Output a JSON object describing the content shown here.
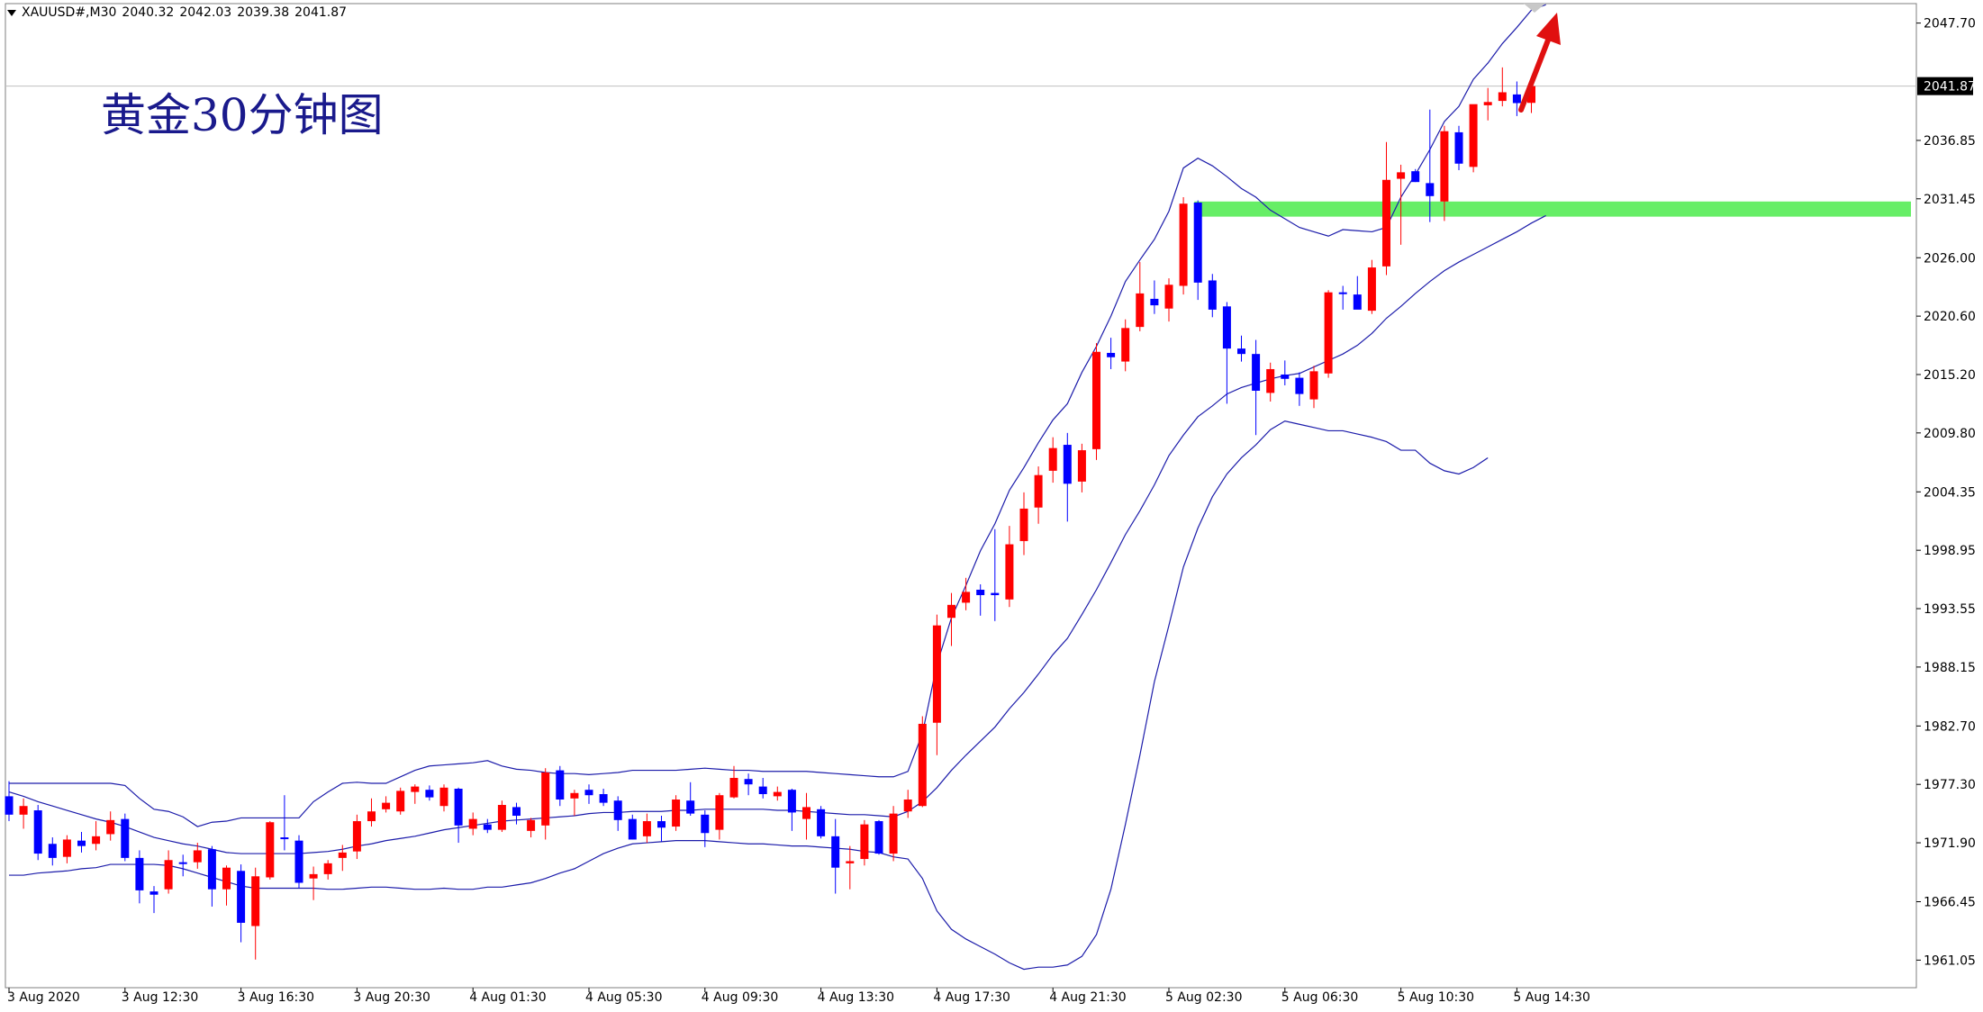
{
  "header": {
    "symbol": "XAUUSD#,M30",
    "open": "2040.32",
    "high": "2042.03",
    "low": "2039.38",
    "close": "2041.87"
  },
  "annotation": {
    "text": "黄金30分钟图"
  },
  "chart_data": {
    "type": "candlestick",
    "timeframe": "M30",
    "ylim": [
      1958.5,
      2049.5
    ],
    "y_ticks": [
      "2047.70",
      "2041.87",
      "2036.85",
      "2031.45",
      "2026.00",
      "2020.60",
      "2015.20",
      "2009.80",
      "2004.35",
      "1998.95",
      "1993.55",
      "1988.15",
      "1982.70",
      "1977.30",
      "1971.90",
      "1966.45",
      "1961.05"
    ],
    "current_price": "2041.87",
    "x_labels": [
      "3 Aug 2020",
      "3 Aug 12:30",
      "3 Aug 16:30",
      "3 Aug 20:30",
      "4 Aug 01:30",
      "4 Aug 05:30",
      "4 Aug 09:30",
      "4 Aug 13:30",
      "4 Aug 17:30",
      "4 Aug 21:30",
      "5 Aug 02:30",
      "5 Aug 06:30",
      "5 Aug 10:30",
      "5 Aug 14:30"
    ],
    "x_label_every": 8,
    "colors": {
      "bull": "#ff0000",
      "bear": "#0000ff",
      "band": "#1c1caa",
      "zone": "#66ee66",
      "arrow": "#e01010",
      "grid": "#c0c0c0"
    },
    "support_zone": [
      2029.8,
      2031.2
    ],
    "candles": [
      [
        1976.2,
        1977.6,
        1973.9,
        1974.5
      ],
      [
        1974.5,
        1976.0,
        1973.2,
        1975.3
      ],
      [
        1974.9,
        1975.4,
        1970.3,
        1970.9
      ],
      [
        1971.8,
        1972.4,
        1969.8,
        1970.5
      ],
      [
        1970.6,
        1972.6,
        1970.0,
        1972.2
      ],
      [
        1972.1,
        1972.9,
        1971.0,
        1971.6
      ],
      [
        1971.8,
        1973.9,
        1971.2,
        1972.5
      ],
      [
        1972.7,
        1974.8,
        1972.1,
        1974.0
      ],
      [
        1974.1,
        1974.6,
        1970.2,
        1970.5
      ],
      [
        1970.5,
        1971.2,
        1966.3,
        1967.5
      ],
      [
        1967.4,
        1967.9,
        1965.4,
        1967.1
      ],
      [
        1967.6,
        1971.2,
        1967.2,
        1970.3
      ],
      [
        1970.1,
        1970.8,
        1968.8,
        1970.0
      ],
      [
        1970.1,
        1971.9,
        1969.5,
        1971.2
      ],
      [
        1971.3,
        1971.6,
        1966.0,
        1967.6
      ],
      [
        1967.6,
        1969.8,
        1966.1,
        1969.6
      ],
      [
        1969.3,
        1969.9,
        1962.7,
        1964.5
      ],
      [
        1964.2,
        1969.6,
        1961.1,
        1968.8
      ],
      [
        1968.7,
        1973.9,
        1968.5,
        1973.8
      ],
      [
        1972.4,
        1976.3,
        1971.2,
        1972.3
      ],
      [
        1972.1,
        1972.6,
        1967.7,
        1968.2
      ],
      [
        1968.6,
        1969.7,
        1966.6,
        1969.0
      ],
      [
        1969.0,
        1970.3,
        1968.5,
        1970.0
      ],
      [
        1970.5,
        1971.7,
        1969.3,
        1971.0
      ],
      [
        1971.1,
        1974.5,
        1970.4,
        1973.9
      ],
      [
        1973.9,
        1976.0,
        1973.4,
        1974.8
      ],
      [
        1975.0,
        1976.2,
        1974.7,
        1975.6
      ],
      [
        1974.8,
        1977.0,
        1974.5,
        1976.7
      ],
      [
        1976.6,
        1977.3,
        1975.5,
        1977.1
      ],
      [
        1976.8,
        1977.2,
        1975.8,
        1976.1
      ],
      [
        1975.3,
        1977.3,
        1974.8,
        1977.0
      ],
      [
        1976.9,
        1977.0,
        1971.9,
        1973.5
      ],
      [
        1973.2,
        1974.7,
        1972.6,
        1974.1
      ],
      [
        1973.6,
        1974.1,
        1972.8,
        1973.1
      ],
      [
        1973.1,
        1975.8,
        1972.9,
        1975.4
      ],
      [
        1975.2,
        1975.6,
        1973.6,
        1974.4
      ],
      [
        1973.0,
        1974.2,
        1972.4,
        1974.0
      ],
      [
        1973.5,
        1978.8,
        1972.2,
        1978.4
      ],
      [
        1978.6,
        1979.0,
        1975.3,
        1975.9
      ],
      [
        1976.0,
        1976.8,
        1974.4,
        1976.5
      ],
      [
        1976.8,
        1977.3,
        1975.5,
        1976.3
      ],
      [
        1976.4,
        1976.9,
        1975.3,
        1975.6
      ],
      [
        1975.8,
        1976.2,
        1973.0,
        1974.0
      ],
      [
        1974.1,
        1974.5,
        1972.2,
        1972.2
      ],
      [
        1972.5,
        1974.6,
        1971.9,
        1973.9
      ],
      [
        1973.9,
        1974.4,
        1972.0,
        1973.3
      ],
      [
        1973.4,
        1976.3,
        1973.0,
        1975.9
      ],
      [
        1975.8,
        1977.5,
        1974.4,
        1974.6
      ],
      [
        1974.5,
        1974.9,
        1971.5,
        1972.8
      ],
      [
        1973.1,
        1976.5,
        1972.2,
        1976.3
      ],
      [
        1976.1,
        1979.0,
        1976.0,
        1977.9
      ],
      [
        1977.8,
        1978.3,
        1976.3,
        1977.3
      ],
      [
        1977.1,
        1977.9,
        1976.0,
        1976.4
      ],
      [
        1976.2,
        1977.1,
        1975.8,
        1976.6
      ],
      [
        1976.8,
        1976.9,
        1973.0,
        1974.7
      ],
      [
        1974.1,
        1976.5,
        1972.2,
        1975.2
      ],
      [
        1975.0,
        1975.3,
        1972.3,
        1972.5
      ],
      [
        1972.5,
        1974.1,
        1967.2,
        1969.6
      ],
      [
        1970.0,
        1971.6,
        1967.6,
        1970.2
      ],
      [
        1970.4,
        1974.0,
        1969.8,
        1973.6
      ],
      [
        1973.9,
        1974.0,
        1970.8,
        1970.9
      ],
      [
        1970.9,
        1975.3,
        1970.2,
        1974.6
      ],
      [
        1974.8,
        1976.8,
        1974.2,
        1975.9
      ],
      [
        1975.3,
        1983.6,
        1975.2,
        1982.9
      ],
      [
        1983.0,
        1993.0,
        1980.0,
        1992.0
      ],
      [
        1992.7,
        1995.0,
        1990.1,
        1993.9
      ],
      [
        1994.1,
        1996.4,
        1993.4,
        1995.1
      ],
      [
        1995.3,
        1995.8,
        1992.9,
        1994.8
      ],
      [
        1995.0,
        2000.9,
        1992.4,
        1994.8
      ],
      [
        1994.4,
        2001.2,
        1993.7,
        1999.5
      ],
      [
        1999.8,
        2004.3,
        1998.5,
        2002.8
      ],
      [
        2002.9,
        2006.7,
        2001.4,
        2005.9
      ],
      [
        2006.3,
        2009.4,
        2005.2,
        2008.4
      ],
      [
        2008.7,
        2009.8,
        2001.6,
        2005.1
      ],
      [
        2005.3,
        2008.8,
        2004.3,
        2008.2
      ],
      [
        2008.3,
        2018.1,
        2007.3,
        2017.3
      ],
      [
        2017.2,
        2018.6,
        2015.7,
        2016.8
      ],
      [
        2016.4,
        2020.3,
        2015.5,
        2019.5
      ],
      [
        2019.6,
        2025.6,
        2019.2,
        2022.7
      ],
      [
        2022.2,
        2023.9,
        2020.8,
        2021.6
      ],
      [
        2021.3,
        2024.1,
        2020.1,
        2023.5
      ],
      [
        2023.4,
        2031.6,
        2022.6,
        2031.0
      ],
      [
        2031.1,
        2031.3,
        2022.1,
        2023.7
      ],
      [
        2023.9,
        2024.5,
        2020.5,
        2021.2
      ],
      [
        2021.5,
        2021.9,
        2012.5,
        2017.6
      ],
      [
        2017.6,
        2018.8,
        2016.4,
        2017.1
      ],
      [
        2017.1,
        2018.4,
        2009.6,
        2013.7
      ],
      [
        2013.5,
        2016.3,
        2012.7,
        2015.7
      ],
      [
        2015.2,
        2016.5,
        2014.2,
        2014.8
      ],
      [
        2014.9,
        2015.4,
        2012.3,
        2013.4
      ],
      [
        2012.9,
        2016.0,
        2012.1,
        2015.5
      ],
      [
        2015.3,
        2023.0,
        2014.9,
        2022.8
      ],
      [
        2022.8,
        2023.4,
        2021.2,
        2022.7
      ],
      [
        2022.6,
        2024.3,
        2021.3,
        2021.2
      ],
      [
        2021.1,
        2025.8,
        2020.8,
        2025.1
      ],
      [
        2025.2,
        2036.7,
        2024.4,
        2033.2
      ],
      [
        2033.3,
        2034.6,
        2027.2,
        2033.9
      ],
      [
        2034.0,
        2034.2,
        2033.0,
        2033.0
      ],
      [
        2032.9,
        2039.7,
        2029.3,
        2031.7
      ],
      [
        2031.2,
        2038.2,
        2029.4,
        2037.7
      ],
      [
        2037.6,
        2038.2,
        2034.1,
        2034.7
      ],
      [
        2034.4,
        2039.7,
        2033.9,
        2040.2
      ],
      [
        2040.1,
        2041.7,
        2038.7,
        2040.4
      ],
      [
        2040.5,
        2043.6,
        2040.0,
        2041.3
      ],
      [
        2041.1,
        2042.3,
        2039.1,
        2040.3
      ],
      [
        2040.32,
        2042.03,
        2039.38,
        2041.87
      ]
    ],
    "bollinger": {
      "upper": [
        1977.4,
        1977.4,
        1977.4,
        1977.4,
        1977.4,
        1977.4,
        1977.4,
        1977.4,
        1977.2,
        1976.0,
        1975.0,
        1974.8,
        1974.3,
        1973.4,
        1973.8,
        1973.9,
        1974.2,
        1974.2,
        1974.2,
        1974.2,
        1974.2,
        1975.7,
        1976.6,
        1977.4,
        1977.5,
        1977.4,
        1977.4,
        1978.0,
        1978.6,
        1979.0,
        1979.1,
        1979.2,
        1979.3,
        1979.5,
        1979.0,
        1978.7,
        1978.6,
        1978.4,
        1978.3,
        1978.3,
        1978.2,
        1978.3,
        1978.4,
        1978.6,
        1978.6,
        1978.6,
        1978.6,
        1978.7,
        1978.8,
        1978.7,
        1978.6,
        1978.6,
        1978.5,
        1978.5,
        1978.5,
        1978.5,
        1978.4,
        1978.3,
        1978.2,
        1978.1,
        1978.0,
        1978.0,
        1978.5,
        1982.0,
        1988.4,
        1992.7,
        1995.7,
        1998.9,
        2001.4,
        2004.5,
        2006.6,
        2008.9,
        2011.0,
        2012.5,
        2015.4,
        2017.8,
        2020.6,
        2023.8,
        2025.8,
        2027.7,
        2030.3,
        2034.3,
        2035.2,
        2034.5,
        2033.5,
        2032.4,
        2031.6,
        2030.4,
        2029.6,
        2028.8,
        2028.4,
        2028.0,
        2028.6,
        2028.5,
        2028.4,
        2028.8,
        2031.6,
        2033.7,
        2036.0,
        2038.6,
        2040.0,
        2042.5,
        2044.0,
        2045.8,
        2047.3,
        2048.9,
        2049.4
      ],
      "middle": [
        1976.6,
        1976.2,
        1975.7,
        1975.3,
        1974.9,
        1974.5,
        1974.1,
        1973.8,
        1973.4,
        1972.9,
        1972.4,
        1972.1,
        1971.8,
        1971.6,
        1971.3,
        1971.0,
        1970.9,
        1970.9,
        1970.9,
        1970.9,
        1970.9,
        1971.0,
        1971.1,
        1971.3,
        1971.6,
        1971.8,
        1972.1,
        1972.3,
        1972.5,
        1972.8,
        1973.1,
        1973.3,
        1973.5,
        1973.7,
        1973.9,
        1974.0,
        1974.1,
        1974.2,
        1974.3,
        1974.4,
        1974.6,
        1974.7,
        1974.7,
        1974.8,
        1974.8,
        1974.8,
        1974.9,
        1974.9,
        1975.0,
        1975.0,
        1975.0,
        1975.0,
        1975.0,
        1974.9,
        1974.9,
        1974.8,
        1974.7,
        1974.6,
        1974.5,
        1974.5,
        1974.4,
        1974.3,
        1974.8,
        1975.7,
        1977.0,
        1978.6,
        1980.0,
        1981.3,
        1982.6,
        1984.3,
        1985.8,
        1987.5,
        1989.3,
        1990.8,
        1993.0,
        1995.3,
        1997.8,
        2000.4,
        2002.6,
        2005.0,
        2007.7,
        2009.6,
        2011.3,
        2012.3,
        2013.4,
        2014.0,
        2014.4,
        2014.8,
        2015.1,
        2015.3,
        2015.9,
        2016.5,
        2017.1,
        2017.9,
        2019.0,
        2020.4,
        2021.5,
        2022.7,
        2023.8,
        2024.8,
        2025.6,
        2026.3,
        2027.0,
        2027.7,
        2028.4,
        2029.2,
        2029.9
      ],
      "lower": [
        1968.9,
        1968.9,
        1969.1,
        1969.2,
        1969.3,
        1969.5,
        1969.6,
        1969.9,
        1969.9,
        1969.9,
        1969.9,
        1969.8,
        1969.5,
        1969.1,
        1968.7,
        1968.3,
        1967.9,
        1967.7,
        1967.7,
        1967.7,
        1967.7,
        1967.7,
        1967.6,
        1967.6,
        1967.7,
        1967.8,
        1967.8,
        1967.7,
        1967.6,
        1967.6,
        1967.7,
        1967.6,
        1967.6,
        1967.8,
        1967.8,
        1968.0,
        1968.2,
        1968.6,
        1969.1,
        1969.5,
        1970.2,
        1970.9,
        1971.4,
        1971.8,
        1971.9,
        1972.0,
        1972.1,
        1972.1,
        1972.1,
        1972.0,
        1971.9,
        1971.8,
        1971.8,
        1971.7,
        1971.6,
        1971.6,
        1971.5,
        1971.4,
        1971.3,
        1971.1,
        1971.0,
        1970.6,
        1970.4,
        1968.6,
        1965.6,
        1963.9,
        1963.0,
        1962.3,
        1961.6,
        1960.8,
        1960.2,
        1960.4,
        1960.4,
        1960.6,
        1961.4,
        1963.4,
        1967.6,
        1973.6,
        1980.0,
        1986.8,
        1992.0,
        1997.4,
        2001.0,
        2003.9,
        2006.0,
        2007.5,
        2008.7,
        2010.1,
        2010.9,
        2010.6,
        2010.3,
        2010.0,
        2010.0,
        2009.7,
        2009.4,
        2009.0,
        2008.2,
        2008.2,
        2007.0,
        2006.3,
        2006.0,
        2006.6,
        2007.5
      ]
    }
  }
}
